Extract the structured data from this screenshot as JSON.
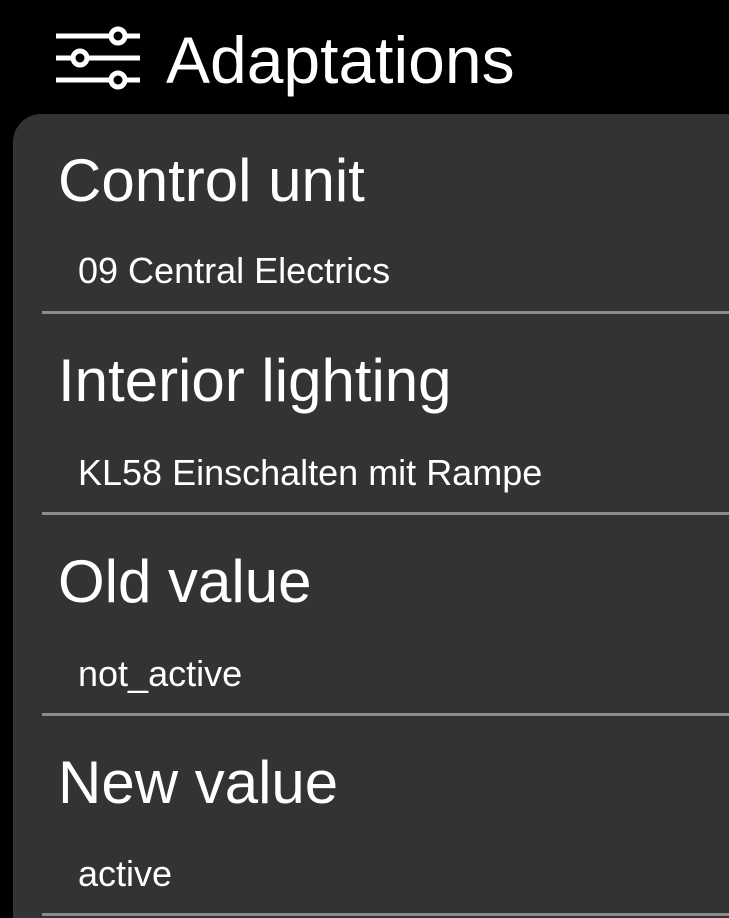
{
  "header": {
    "icon": "sliders-icon",
    "title": "Adaptations"
  },
  "rows": [
    {
      "title": "Control unit",
      "value": "09 Central Electrics"
    },
    {
      "title": "Interior lighting",
      "value": "KL58 Einschalten mit Rampe"
    },
    {
      "title": "Old value",
      "value": "not_active"
    },
    {
      "title": "New value",
      "value": "active"
    }
  ],
  "colors": {
    "header_bg": "#000000",
    "card_bg": "#333333",
    "text": "#ffffff",
    "divider": "#8c8c8c"
  }
}
